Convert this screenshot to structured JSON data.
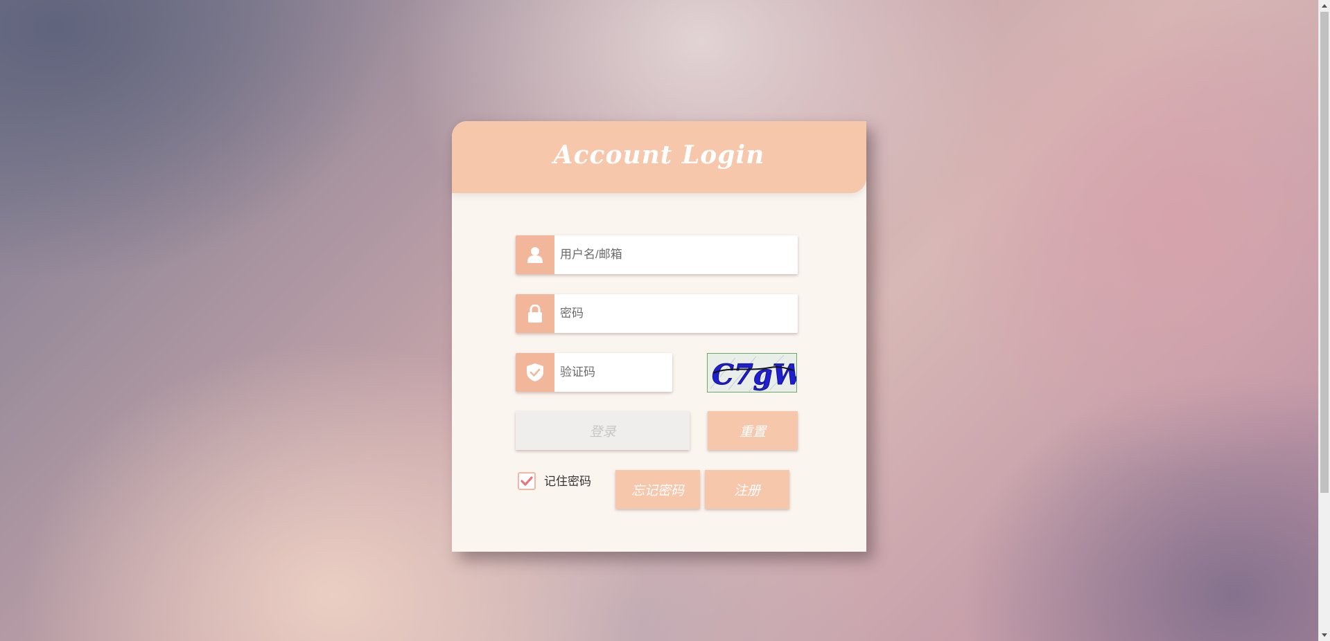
{
  "login": {
    "title": "Account Login",
    "username_placeholder": "用户名/邮箱",
    "password_placeholder": "密码",
    "captcha_placeholder": "验证码",
    "captcha_text": "C7gW",
    "login_label": "登录",
    "reset_label": "重置",
    "remember_label": "记住密码",
    "remember_checked": true,
    "forgot_label": "忘记密码",
    "register_label": "注册"
  },
  "icons": {
    "username": "user-icon",
    "password": "lock-icon",
    "captcha": "shield-check-icon",
    "remember": "checkmark-icon"
  },
  "colors": {
    "accent": "#f7c7ab",
    "icon_bg": "#f2b79a",
    "card_bg": "#fbf5f0",
    "login_disabled_bg": "#efeeec"
  }
}
